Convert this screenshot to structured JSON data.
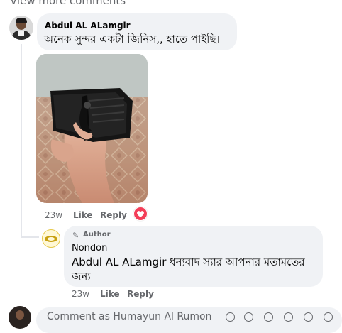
{
  "thread": {
    "view_more_label": "View more comments"
  },
  "comments": [
    {
      "author": "Abdul AL ALamgir",
      "text": "অনেক সুন্দর একটা জিনিস,, হাতে পাইছি।",
      "photo_description": "Hand holding an open black leather wallet",
      "time": "23w",
      "like_label": "Like",
      "reply_label": "Reply",
      "reaction_icon": "heart-icon",
      "reaction_color": "#f33e58"
    }
  ],
  "reply": {
    "badge": "Author",
    "badge_icon": "pencil-icon",
    "author": "Nondon",
    "mention": "Abdul AL ALamgir",
    "text_line1": " ধন্যবাদ স্যার আপনার মতামতের",
    "text_line2": "জন্য",
    "time": "23w",
    "like_label": "Like",
    "reply_label": "Reply"
  },
  "composer": {
    "placeholder": "Comment as Humayun Al Rumon"
  }
}
